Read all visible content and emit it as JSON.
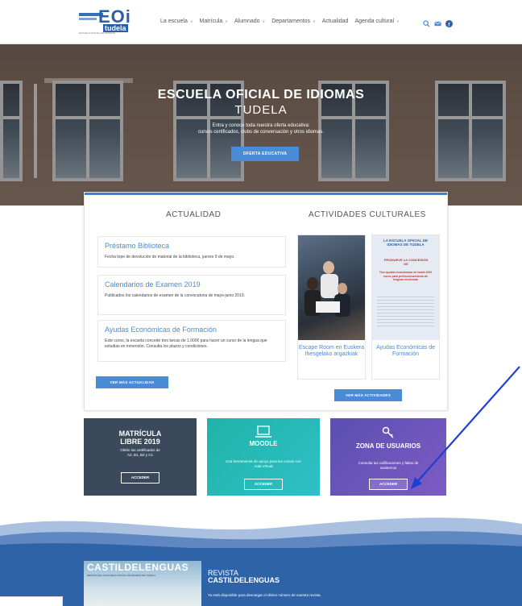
{
  "header": {
    "logo": {
      "mark": "EOi",
      "name": "tudela",
      "subtitle": "ESCUELA OFICIAL DE IDIOMAS"
    },
    "nav": [
      {
        "label": "La escuela",
        "dropdown": true
      },
      {
        "label": "Matrícula",
        "dropdown": true
      },
      {
        "label": "Alumnado",
        "dropdown": true
      },
      {
        "label": "Departamentos",
        "dropdown": true
      },
      {
        "label": "Actualidad",
        "dropdown": false
      },
      {
        "label": "Agenda cultural",
        "dropdown": true
      }
    ],
    "icons": [
      "search-icon",
      "mail-icon",
      "facebook-icon"
    ]
  },
  "hero": {
    "title": "ESCUELA OFICIAL DE IDIOMAS",
    "subtitle": "TUDELA",
    "desc1": "Entra y conoce toda nuestra oferta educativa:",
    "desc2": "cursos certificados, clubs de conversación y otros idiomas.",
    "button": "OFERTA EDUCATIVA"
  },
  "news": {
    "heading": "ACTUALIDAD",
    "items": [
      {
        "title": "Préstamo Biblioteca",
        "desc": "Fecha tope de devolución de material de la biblioteca, jueves 9 de mayo."
      },
      {
        "title": "Calendarios de Examen 2019",
        "desc": "Publicados los calendarios de examen de la convocatoria de mayo-junio 2019."
      },
      {
        "title": "Ayudas Económicas de Formación",
        "desc": "Este curso, la escuela concede tres becas de 1.000€ para hacer un curso de la lengua que estudias en inmersión. Consulta los plazos y condiciones."
      }
    ],
    "more": "VER MÁS ACTUALIDAD"
  },
  "activities": {
    "heading": "ACTIVIDADES CULTURALES",
    "items": [
      {
        "caption": "Escape Room en Euskera Ihesgelako argazkiak"
      },
      {
        "caption": "Ayudas Económicas de Formación",
        "poster_title": "LA ESCUELA OFICIAL DE IDIOMAS DE TUDELA",
        "poster_sub": "PROMUEVE LA CONCESIÓN DE",
        "poster_text": "Tres ayudas económicas de hasta 1000 euros para perfeccionamiento de lenguas modernas"
      }
    ],
    "more": "VER MÁS ACTIVIDADES"
  },
  "boxes": [
    {
      "title1": "MATRÍCULA",
      "title2": "LIBRE 2019",
      "desc1": "Obtén los certificados de",
      "desc2": "A2, B1, B2 y C1",
      "button": "ACCEDER",
      "color": "#3a4a5c"
    },
    {
      "title1": "MOODLE",
      "title2": "",
      "desc1": "Una herramienta de apoyo para tus cursos con",
      "desc2": "Aula Virtual",
      "button": "ACCEDER",
      "color": "#26b0a6"
    },
    {
      "title1": "ZONA DE USUARIOS",
      "title2": "",
      "desc1": "Consulta tus calificaciones y faltas de",
      "desc2": "asistencia",
      "button": "ACCEDER",
      "color": "#6a58b8"
    }
  ],
  "footer": {
    "mag_title": "CASTILDELENGUAS",
    "mag_sub": "REVISTA DE LA ESCUELA OFICIAL DE IDIOMAS DE TUDELA",
    "rev_label": "REVISTA",
    "rev_title": "CASTILDELENGUAS",
    "rev_desc": "Ya está disponible para descargar el último número de nuestra revista."
  }
}
